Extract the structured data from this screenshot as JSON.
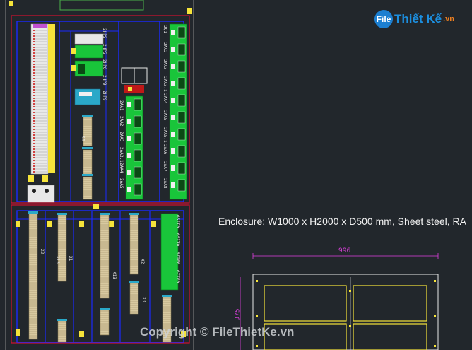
{
  "drawing": {
    "enclosure_note": "Enclosure: W1000 x H2000 x D500 mm, Sheet steel, RA",
    "dimension_width": "996",
    "dimension_height": "975",
    "breaker_labels": [
      "2Q1",
      "2AA2",
      "2AA3",
      "2AA3.1",
      "2AA4",
      "2AA5",
      "2AA5.1",
      "2AA6",
      "2AA7",
      "2AA8"
    ],
    "lower_labels": [
      "2AA1",
      "2AA2",
      "2AA3",
      "2AA3.1",
      "2AA4",
      "2AA5"
    ],
    "psu_labels": [
      "2HP5",
      "2HP5",
      "2HP6",
      "2HP9",
      "2HP9"
    ],
    "terminal_labels": [
      "X2",
      "X13",
      "X1",
      "X13",
      "X2",
      "X3",
      "X4"
    ],
    "pi_labels": [
      "6SIT0",
      "6SIT0",
      "6ZTF0",
      "6ZTF0"
    ]
  },
  "watermark": {
    "logo_mark": "File",
    "logo_brand": "Thiết Kế",
    "logo_sub": ".vn",
    "copyright": "Copyright © FileThietKe.vn"
  },
  "colors": {
    "background": "#22272c",
    "panel_border": "#d01030",
    "rail_blue": "#1a2aff",
    "yellow": "#f6e43a",
    "green": "#19c53a",
    "terminal_tan": "#d8c9a0",
    "dimension_magenta": "#e040e0"
  }
}
